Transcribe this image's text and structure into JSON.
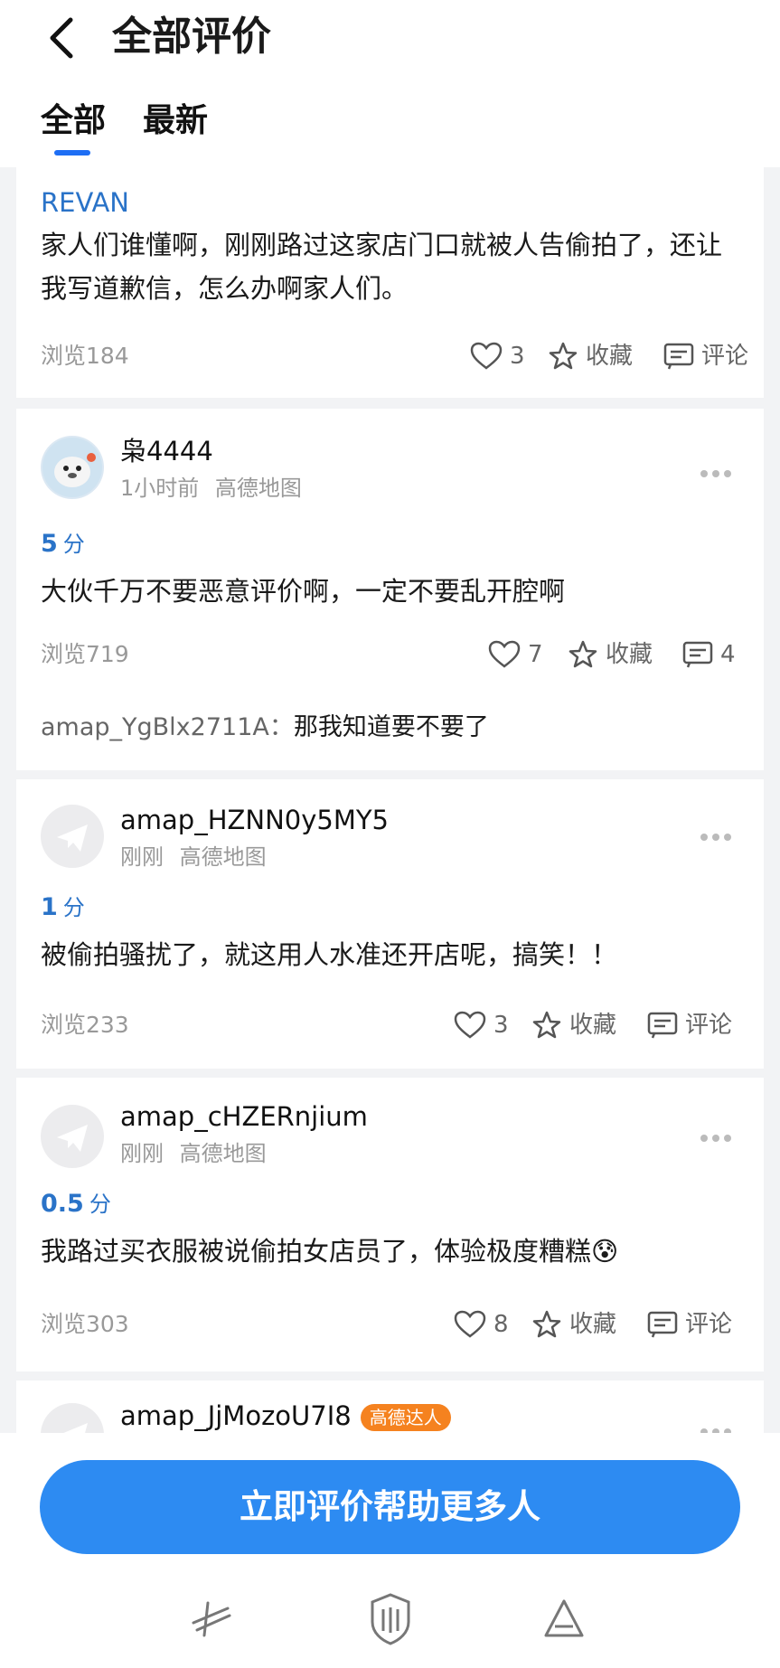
{
  "header": {
    "title": "全部评价"
  },
  "tabs": [
    {
      "label": "全部"
    },
    {
      "label": "最新"
    }
  ],
  "reviews": [
    {
      "username": "REVAN",
      "text": "家人们谁懂啊，刚刚路过这家店门口就被人告偷拍了，还让我写道歉信，怎么办啊家人们。",
      "views": "浏览184",
      "likes": "3",
      "favorite_label": "收藏",
      "comment_label": "评论"
    },
    {
      "username": "枭4444",
      "time": "1小时前",
      "source": "高德地图",
      "score": "5",
      "score_unit": "分",
      "text": "大伙千万不要恶意评价啊，一定不要乱开腔啊",
      "views": "浏览719",
      "likes": "7",
      "favorite_label": "收藏",
      "comment_count": "4",
      "reply_user": "amap_YgBlx2711A：",
      "reply_text": "那我知道要不要了"
    },
    {
      "username": "amap_HZNN0y5MY5",
      "time": "刚刚",
      "source": "高德地图",
      "score": "1",
      "score_unit": "分",
      "text": "被偷拍骚扰了，就这用人水准还开店呢，搞笑！！",
      "views": "浏览233",
      "likes": "3",
      "favorite_label": "收藏",
      "comment_label": "评论"
    },
    {
      "username": "amap_cHZERnjium",
      "time": "刚刚",
      "source": "高德地图",
      "score": "0.5",
      "score_unit": "分",
      "text": "我路过买衣服被说偷拍女店员了，体验极度糟糕😰",
      "views": "浏览303",
      "likes": "8",
      "favorite_label": "收藏",
      "comment_label": "评论"
    },
    {
      "username": "amap_JjMozoU7I8",
      "badge": "高德达人"
    }
  ],
  "cta": {
    "label": "立即评价帮助更多人"
  },
  "colors": {
    "accent": "#1e6ef4",
    "cta": "#2d8bf2",
    "score": "#2a73c8",
    "badge": "#f5821f"
  }
}
